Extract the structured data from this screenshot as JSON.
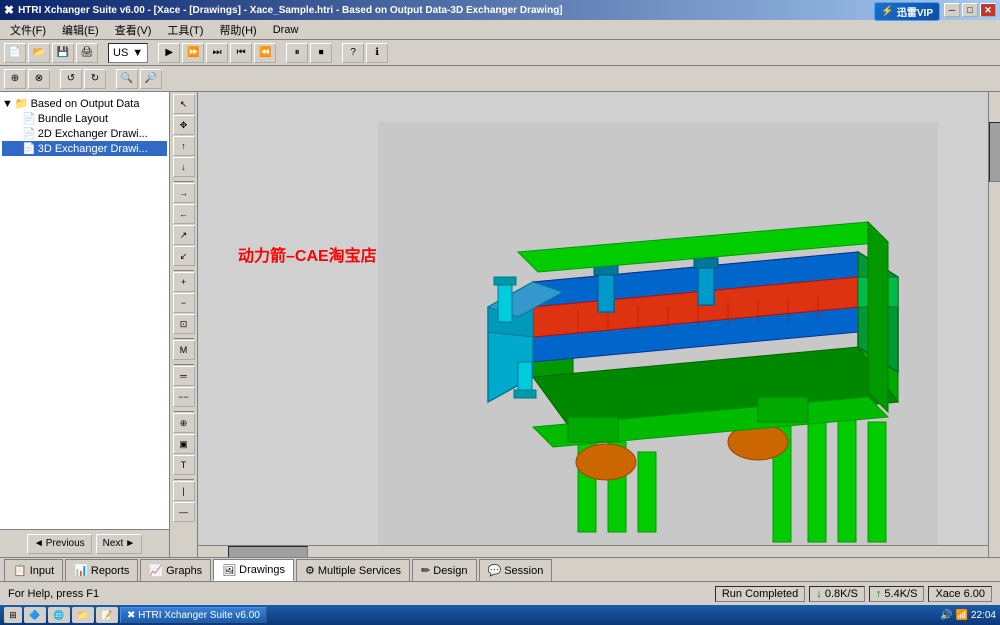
{
  "titlebar": {
    "title": "HTRI Xchanger Suite v6.00 - [Xace - [Drawings] - Xace_Sample.htri - Based on Output Data-3D Exchanger Drawing]",
    "thunder_vip": "迅雷VIP",
    "min_btn": "─",
    "max_btn": "□",
    "close_btn": "✕"
  },
  "menubar": {
    "items": [
      "文件(F)",
      "编辑(E)",
      "查看(V)",
      "工具(T)",
      "帮助(H)",
      "Draw"
    ]
  },
  "toolbar1": {
    "dropdown_value": "US"
  },
  "tree": {
    "root_label": "Based on Output Data",
    "children": [
      "Bundle Layout",
      "2D Exchanger Drawi...",
      "3D Exchanger Drawi..."
    ]
  },
  "nav": {
    "previous": "◄ Previous",
    "next": "Next ►"
  },
  "watermark": {
    "line1": "动力箭–CAE淘宝店"
  },
  "tabs": [
    {
      "label": "Input",
      "icon": "input-icon",
      "active": false
    },
    {
      "label": "Reports",
      "icon": "reports-icon",
      "active": false
    },
    {
      "label": "Graphs",
      "icon": "graphs-icon",
      "active": false
    },
    {
      "label": "Drawings",
      "icon": "drawings-icon",
      "active": true
    },
    {
      "label": "Multiple Services",
      "icon": "ms-icon",
      "active": false
    },
    {
      "label": "Design",
      "icon": "design-icon",
      "active": false
    },
    {
      "label": "Session",
      "icon": "session-icon",
      "active": false
    }
  ],
  "statusbar": {
    "help_text": "For Help, press F1",
    "run_status": "Run Completed",
    "speed1": "0.8K/S",
    "speed2": "5.4K/S",
    "version": "Xace 6.00",
    "time": "22:04"
  },
  "taskbar": {
    "start_icon": "⊞",
    "apps": [
      "HTRI Xchanger Suite v6.00"
    ],
    "tray_icons": [
      "🔊",
      "📶"
    ],
    "time": "22:04"
  }
}
